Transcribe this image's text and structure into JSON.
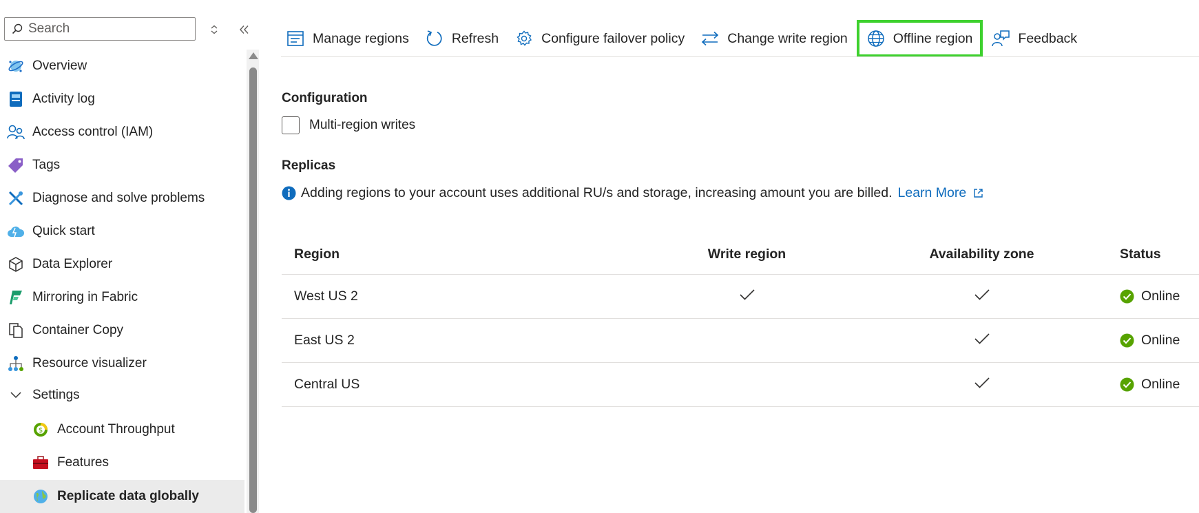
{
  "sidebar": {
    "search_placeholder": "Search",
    "items": [
      {
        "label": "Overview",
        "icon": "cosmos-db-icon"
      },
      {
        "label": "Activity log",
        "icon": "activity-log-icon"
      },
      {
        "label": "Access control (IAM)",
        "icon": "people-icon"
      },
      {
        "label": "Tags",
        "icon": "tag-icon"
      },
      {
        "label": "Diagnose and solve problems",
        "icon": "wrench-icon"
      },
      {
        "label": "Quick start",
        "icon": "cloud-icon"
      },
      {
        "label": "Data Explorer",
        "icon": "cube-icon"
      },
      {
        "label": "Mirroring in Fabric",
        "icon": "fabric-icon"
      },
      {
        "label": "Container Copy",
        "icon": "copy-icon"
      },
      {
        "label": "Resource visualizer",
        "icon": "hierarchy-icon"
      }
    ],
    "settings_label": "Settings",
    "settings_items": [
      {
        "label": "Account Throughput",
        "icon": "throughput-icon"
      },
      {
        "label": "Features",
        "icon": "toolbox-icon"
      },
      {
        "label": "Replicate data globally",
        "icon": "globe-icon",
        "selected": true
      }
    ]
  },
  "toolbar": {
    "manage_regions": "Manage regions",
    "refresh": "Refresh",
    "configure_failover": "Configure failover policy",
    "change_write_region": "Change write region",
    "offline_region": "Offline region",
    "feedback": "Feedback",
    "highlight_color": "#3ed12e"
  },
  "configuration": {
    "title": "Configuration",
    "multi_region_writes_label": "Multi-region writes",
    "multi_region_writes_checked": false
  },
  "replicas": {
    "title": "Replicas",
    "info_text": "Adding regions to your account uses additional RU/s and storage, increasing amount you are billed.",
    "learn_more": "Learn More",
    "columns": {
      "region": "Region",
      "write_region": "Write region",
      "availability_zone": "Availability zone",
      "status": "Status"
    },
    "rows": [
      {
        "region": "West US 2",
        "write_region": true,
        "availability_zone": true,
        "status": "Online"
      },
      {
        "region": "East US 2",
        "write_region": false,
        "availability_zone": true,
        "status": "Online"
      },
      {
        "region": "Central US",
        "write_region": false,
        "availability_zone": true,
        "status": "Online"
      }
    ]
  },
  "colors": {
    "accent": "#0f6cbd",
    "online": "#57a300"
  }
}
